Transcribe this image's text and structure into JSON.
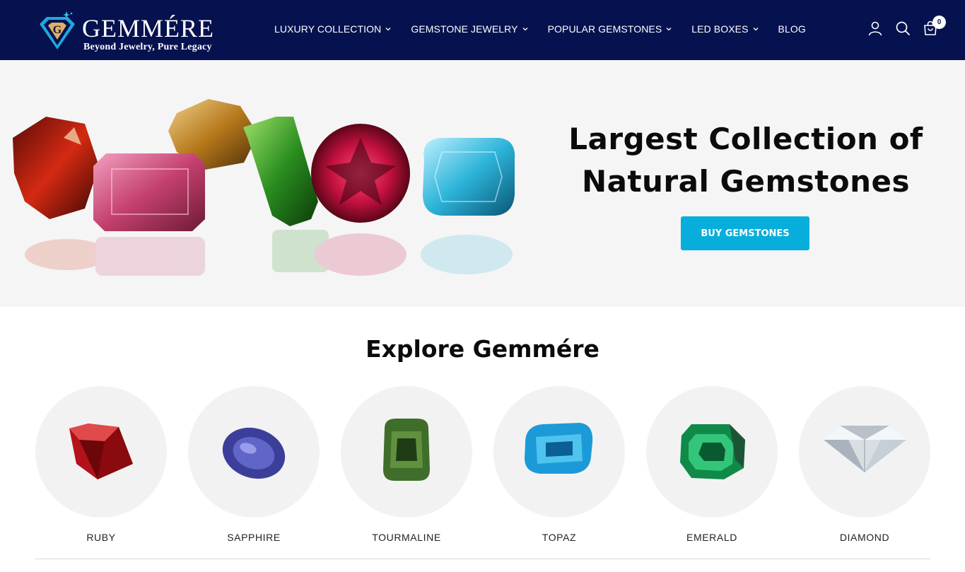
{
  "header": {
    "logo": {
      "word": "GEMMÉRE",
      "tagline": "Beyond Jewelry, Pure Legacy"
    },
    "nav": [
      {
        "label": "LUXURY COLLECTION",
        "has_dropdown": true
      },
      {
        "label": "GEMSTONE JEWELRY",
        "has_dropdown": true
      },
      {
        "label": "POPULAR GEMSTONES",
        "has_dropdown": true
      },
      {
        "label": "LED BOXES",
        "has_dropdown": true
      },
      {
        "label": "BLOG",
        "has_dropdown": false
      }
    ],
    "icons": [
      "account-icon",
      "search-icon",
      "cart-icon"
    ],
    "cart_count": "0"
  },
  "hero": {
    "title_line1": "Largest Collection of",
    "title_line2": "Natural Gemstones",
    "button_label": "BUY GEMSTONES"
  },
  "explore": {
    "title": "Explore Gemmére",
    "categories": [
      {
        "label": "RUBY",
        "color": "#b3121a"
      },
      {
        "label": "SAPPHIRE",
        "color": "#3c3f9a"
      },
      {
        "label": "TOURMALINE",
        "color": "#3f6e2a"
      },
      {
        "label": "TOPAZ",
        "color": "#1c9ad8"
      },
      {
        "label": "EMERALD",
        "color": "#0f8a49"
      },
      {
        "label": "DIAMOND",
        "color": "#d9dee3"
      }
    ]
  },
  "colors": {
    "header_bg": "#06124f",
    "hero_bg": "#f5f5f5",
    "accent": "#08aedb",
    "circle_bg": "#f2f2f2"
  }
}
